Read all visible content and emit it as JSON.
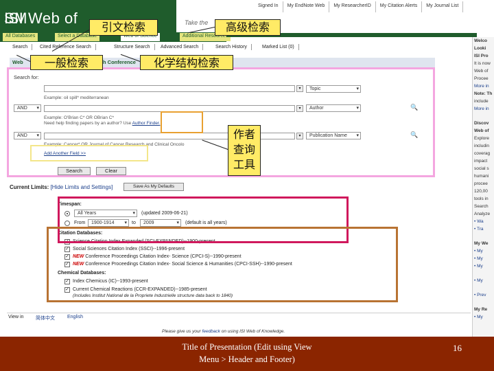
{
  "header": {
    "logo_text": "ISI Web of",
    "logo_sm": "SM",
    "take_text": "Take the",
    "top_links": [
      "Signed In",
      "My EndNote Web",
      "My ResearcherID",
      "My Citation Alerts",
      "My Journal List"
    ]
  },
  "db_tabs": [
    "All Databases",
    "Select a Database",
    "Web of Science",
    "Additional Resources"
  ],
  "search_tabs": [
    "Search",
    "Cited Reference Search",
    "Structure Search",
    "Advanced Search",
    "Search History",
    "Marked List (0)"
  ],
  "search_bar": {
    "left": "Web",
    "right": "h Conference"
  },
  "search_for_label": "Search for:",
  "row1": {
    "example": "Example: oil spill* mediterranean",
    "field": "Topic"
  },
  "row2": {
    "op": "AND",
    "example": "Example: O'Brian C* OR OBrian C*",
    "help": "Need help finding papers by an author? Use",
    "help_link": "Author Finder.",
    "field": "Author"
  },
  "row3": {
    "op": "AND",
    "example": "Example: Cancer* OR Journal of Cancer Research and Clinical Oncolo",
    "field": "Publication Name"
  },
  "add_field": "Add Another Field >>",
  "buttons": {
    "search": "Search",
    "clear": "Clear"
  },
  "limits": {
    "title": "Current Limits:",
    "hide": "[Hide Limits and Settings]",
    "save": "Save As My Defaults",
    "timespan_label": "Timespan:",
    "timespan_all": "All Years",
    "timespan_updated": "(updated 2009-06-21)",
    "from_label": "From",
    "from_value": "1900-1914",
    "to_label": "to",
    "to_value": "2009",
    "default_note": "(default is all years)",
    "citation_label": "Citation Databases:",
    "citation_items": [
      {
        "new": "",
        "text": "Science Citation Index Expanded (SCI-EXPANDED)--1900-present"
      },
      {
        "new": "",
        "text": "Social Sciences Citation Index (SSCI)--1996-present"
      },
      {
        "new": "NEW",
        "text": "Conference Proceedings Citation Index- Science (CPCI-S)--1990-present"
      },
      {
        "new": "NEW",
        "text": "Conference Proceedings Citation Index- Social Science & Humanities (CPCI-SSH)--1990-present"
      }
    ],
    "chem_label": "Chemical Databases:",
    "chem_items": [
      {
        "text": "Index Chemicus (IC)--1993-present"
      },
      {
        "text": "Current Chemical Reactions (CCR-EXPANDED)--1985-present"
      }
    ],
    "chem_note": "(Includes Institut National de la Propriete Industrielle structure data back to 1840)"
  },
  "bottom": {
    "view": "View in",
    "lang": "简体中文",
    "english": "English"
  },
  "feedback": {
    "pre": "Please give us your",
    "link": "feedback",
    "post": "on using ISI Web of Knowledge."
  },
  "right_col": [
    {
      "text": "Welco",
      "style": "bold"
    },
    {
      "text": "Looki",
      "style": "bold"
    },
    {
      "text": "ISI Pro",
      "style": "bold"
    },
    {
      "text": "It is now",
      "style": ""
    },
    {
      "text": "Web of",
      "style": ""
    },
    {
      "text": "Procee",
      "style": ""
    },
    {
      "text": "More in",
      "style": "link"
    },
    {
      "text": "Note: Th",
      "style": "bold"
    },
    {
      "text": "include",
      "style": ""
    },
    {
      "text": "More in",
      "style": "link"
    },
    {
      "text": "",
      "style": ""
    },
    {
      "text": "Discov",
      "style": "bold"
    },
    {
      "text": "Web of",
      "style": "bold"
    },
    {
      "text": "Explore",
      "style": ""
    },
    {
      "text": "includin",
      "style": ""
    },
    {
      "text": "coverag",
      "style": ""
    },
    {
      "text": "impact",
      "style": ""
    },
    {
      "text": "social s",
      "style": ""
    },
    {
      "text": "humani",
      "style": ""
    },
    {
      "text": "procee",
      "style": ""
    },
    {
      "text": "120,00",
      "style": ""
    },
    {
      "text": "tools in",
      "style": ""
    },
    {
      "text": "Search",
      "style": ""
    },
    {
      "text": "Analyze",
      "style": ""
    },
    {
      "text": "• Wa",
      "style": "link"
    },
    {
      "text": "• Tra",
      "style": "link"
    },
    {
      "text": "",
      "style": ""
    },
    {
      "text": "My We",
      "style": "bold"
    },
    {
      "text": "• My",
      "style": "link"
    },
    {
      "text": "• My",
      "style": "link"
    },
    {
      "text": "• My",
      "style": "link"
    },
    {
      "text": "",
      "style": ""
    },
    {
      "text": "• My",
      "style": "link"
    },
    {
      "text": "",
      "style": ""
    },
    {
      "text": "• Prev",
      "style": "link"
    },
    {
      "text": "",
      "style": ""
    },
    {
      "text": "My Re",
      "style": "bold"
    },
    {
      "text": "• My",
      "style": "link"
    }
  ],
  "annotations": {
    "cited_ref": "引文检索",
    "advanced": "高级检索",
    "general": "一般检索",
    "structure": "化学结构检索",
    "author_tool": [
      "作者",
      "查询",
      "工具"
    ]
  },
  "colors": {
    "logo_green": "#1f5c2c",
    "footer": "#8b2500",
    "callout": "#ffeb66",
    "pink_frame": "#f4a6e0",
    "crimson_frame": "#d0185c",
    "brown_frame": "#b87333",
    "orange_frame": "#e8a030",
    "yellow_frame": "#f3e68a"
  },
  "footer": {
    "title_line1": "Title of Presentation (Edit using View",
    "title_line2": "Menu > Header and Footer)",
    "page": "16"
  }
}
